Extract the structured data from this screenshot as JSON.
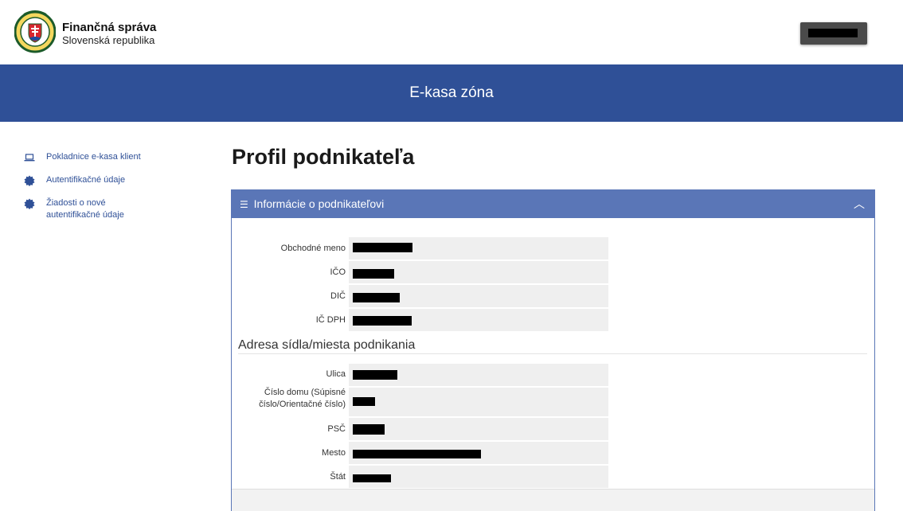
{
  "header": {
    "brand_title": "Finančná správa",
    "brand_subtitle": "Slovenská republika"
  },
  "banner": {
    "title": "E-kasa zóna"
  },
  "sidebar": {
    "items": [
      {
        "label": "Pokladnice e-kasa klient",
        "icon": "laptop-icon"
      },
      {
        "label": "Autentifikačné údaje",
        "icon": "seal-icon"
      },
      {
        "label": "Žiadosti o nové autentifikačné údaje",
        "icon": "seal-icon"
      }
    ]
  },
  "page": {
    "title": "Profil podnikateľa"
  },
  "panel": {
    "title": "Informácie o podnikateľovi",
    "fields": [
      {
        "label": "Obchodné meno"
      },
      {
        "label": "IČO"
      },
      {
        "label": "DIČ"
      },
      {
        "label": "IČ DPH"
      }
    ],
    "address_title": "Adresa sídla/miesta podnikania",
    "address_fields": [
      {
        "label": "Ulica"
      },
      {
        "label": "Číslo domu (Súpisné číslo/Orientačné číslo)"
      },
      {
        "label": "PSČ"
      },
      {
        "label": "Mesto"
      },
      {
        "label": "Štát"
      }
    ]
  },
  "colors": {
    "brand_blue": "#2f5097",
    "panel_header": "#5a76b7"
  }
}
